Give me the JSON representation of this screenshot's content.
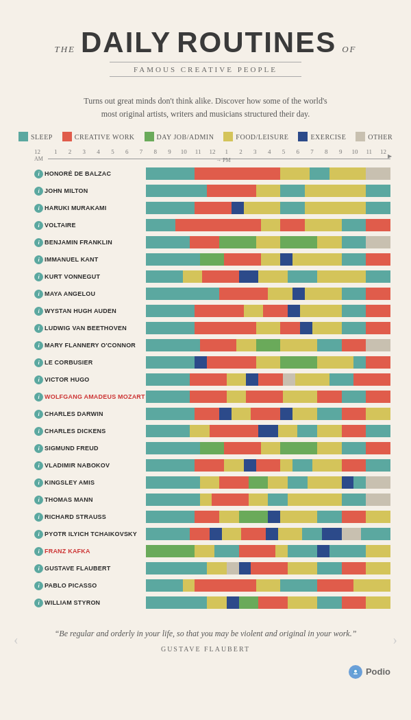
{
  "header": {
    "the": "THE",
    "daily": "DAILY",
    "routines": "ROUTINES",
    "of": "OF",
    "subtitle": "Famous Creative People",
    "description1": "Turns out great minds don't think alike. Discover how some of the world's",
    "description2": "most original artists, writers and musicians structured their day."
  },
  "legend": [
    {
      "label": "Sleep",
      "color": "sleep",
      "key": "sleep"
    },
    {
      "label": "Creative Work",
      "color": "creative",
      "key": "creative"
    },
    {
      "label": "Day Job/Admin",
      "color": "dayjob",
      "key": "dayjob"
    },
    {
      "label": "Food/Leisure",
      "color": "food",
      "key": "food"
    },
    {
      "label": "Exercise",
      "color": "exercise",
      "key": "exercise"
    },
    {
      "label": "Other",
      "color": "other",
      "key": "other"
    }
  ],
  "time_labels": [
    "12",
    "1",
    "2",
    "3",
    "4",
    "5",
    "6",
    "7",
    "8",
    "9",
    "10",
    "11",
    "12",
    "1",
    "2",
    "3",
    "4",
    "5",
    "6",
    "7",
    "8",
    "9",
    "10",
    "11",
    "12"
  ],
  "am_label": "AM",
  "pm_label": "PM",
  "people": [
    {
      "name": "Honoré de Balzac",
      "name_color": "dark",
      "bars": [
        {
          "type": "sleep",
          "pct": 20
        },
        {
          "type": "creative",
          "pct": 35
        },
        {
          "type": "food",
          "pct": 12
        },
        {
          "type": "sleep",
          "pct": 8
        },
        {
          "type": "food",
          "pct": 15
        },
        {
          "type": "other",
          "pct": 10
        }
      ]
    },
    {
      "name": "John Milton",
      "name_color": "dark",
      "bars": [
        {
          "type": "sleep",
          "pct": 25
        },
        {
          "type": "creative",
          "pct": 20
        },
        {
          "type": "food",
          "pct": 10
        },
        {
          "type": "sleep",
          "pct": 10
        },
        {
          "type": "food",
          "pct": 25
        },
        {
          "type": "sleep",
          "pct": 10
        }
      ]
    },
    {
      "name": "Haruki Murakami",
      "name_color": "dark",
      "bars": [
        {
          "type": "sleep",
          "pct": 20
        },
        {
          "type": "creative",
          "pct": 15
        },
        {
          "type": "exercise",
          "pct": 5
        },
        {
          "type": "food",
          "pct": 15
        },
        {
          "type": "sleep",
          "pct": 10
        },
        {
          "type": "food",
          "pct": 25
        },
        {
          "type": "sleep",
          "pct": 10
        }
      ]
    },
    {
      "name": "Voltaire",
      "name_color": "dark",
      "bars": [
        {
          "type": "sleep",
          "pct": 12
        },
        {
          "type": "creative",
          "pct": 35
        },
        {
          "type": "food",
          "pct": 8
        },
        {
          "type": "creative",
          "pct": 10
        },
        {
          "type": "food",
          "pct": 15
        },
        {
          "type": "sleep",
          "pct": 10
        },
        {
          "type": "creative",
          "pct": 10
        }
      ]
    },
    {
      "name": "Benjamin Franklin",
      "name_color": "dark",
      "bars": [
        {
          "type": "sleep",
          "pct": 18
        },
        {
          "type": "creative",
          "pct": 12
        },
        {
          "type": "dayjob",
          "pct": 15
        },
        {
          "type": "food",
          "pct": 10
        },
        {
          "type": "dayjob",
          "pct": 15
        },
        {
          "type": "food",
          "pct": 10
        },
        {
          "type": "sleep",
          "pct": 10
        },
        {
          "type": "other",
          "pct": 10
        }
      ]
    },
    {
      "name": "Immanuel Kant",
      "name_color": "dark",
      "bars": [
        {
          "type": "sleep",
          "pct": 22
        },
        {
          "type": "dayjob",
          "pct": 10
        },
        {
          "type": "creative",
          "pct": 15
        },
        {
          "type": "food",
          "pct": 8
        },
        {
          "type": "exercise",
          "pct": 5
        },
        {
          "type": "food",
          "pct": 20
        },
        {
          "type": "sleep",
          "pct": 10
        },
        {
          "type": "creative",
          "pct": 10
        }
      ]
    },
    {
      "name": "Kurt Vonnegut",
      "name_color": "dark",
      "bars": [
        {
          "type": "sleep",
          "pct": 15
        },
        {
          "type": "food",
          "pct": 8
        },
        {
          "type": "creative",
          "pct": 15
        },
        {
          "type": "exercise",
          "pct": 8
        },
        {
          "type": "food",
          "pct": 12
        },
        {
          "type": "sleep",
          "pct": 12
        },
        {
          "type": "food",
          "pct": 20
        },
        {
          "type": "sleep",
          "pct": 10
        }
      ]
    },
    {
      "name": "Maya Angelou",
      "name_color": "dark",
      "bars": [
        {
          "type": "sleep",
          "pct": 30
        },
        {
          "type": "creative",
          "pct": 20
        },
        {
          "type": "food",
          "pct": 10
        },
        {
          "type": "exercise",
          "pct": 5
        },
        {
          "type": "food",
          "pct": 15
        },
        {
          "type": "sleep",
          "pct": 10
        },
        {
          "type": "creative",
          "pct": 10
        }
      ]
    },
    {
      "name": "Wystan Hugh Auden",
      "name_color": "dark",
      "bars": [
        {
          "type": "sleep",
          "pct": 20
        },
        {
          "type": "creative",
          "pct": 20
        },
        {
          "type": "food",
          "pct": 8
        },
        {
          "type": "creative",
          "pct": 10
        },
        {
          "type": "exercise",
          "pct": 5
        },
        {
          "type": "food",
          "pct": 17
        },
        {
          "type": "sleep",
          "pct": 10
        },
        {
          "type": "creative",
          "pct": 10
        }
      ]
    },
    {
      "name": "Ludwig van Beethoven",
      "name_color": "dark",
      "bars": [
        {
          "type": "sleep",
          "pct": 20
        },
        {
          "type": "creative",
          "pct": 25
        },
        {
          "type": "food",
          "pct": 10
        },
        {
          "type": "creative",
          "pct": 8
        },
        {
          "type": "exercise",
          "pct": 5
        },
        {
          "type": "food",
          "pct": 12
        },
        {
          "type": "sleep",
          "pct": 10
        },
        {
          "type": "creative",
          "pct": 10
        }
      ]
    },
    {
      "name": "Mary Flannery O'Connor",
      "name_color": "dark",
      "bars": [
        {
          "type": "sleep",
          "pct": 22
        },
        {
          "type": "creative",
          "pct": 15
        },
        {
          "type": "food",
          "pct": 8
        },
        {
          "type": "dayjob",
          "pct": 10
        },
        {
          "type": "food",
          "pct": 15
        },
        {
          "type": "sleep",
          "pct": 10
        },
        {
          "type": "creative",
          "pct": 10
        },
        {
          "type": "other",
          "pct": 10
        }
      ]
    },
    {
      "name": "Le Corbusier",
      "name_color": "dark",
      "bars": [
        {
          "type": "sleep",
          "pct": 20
        },
        {
          "type": "exercise",
          "pct": 5
        },
        {
          "type": "creative",
          "pct": 20
        },
        {
          "type": "food",
          "pct": 10
        },
        {
          "type": "dayjob",
          "pct": 15
        },
        {
          "type": "food",
          "pct": 15
        },
        {
          "type": "sleep",
          "pct": 5
        },
        {
          "type": "creative",
          "pct": 10
        }
      ]
    },
    {
      "name": "Victor Hugo",
      "name_color": "dark",
      "bars": [
        {
          "type": "sleep",
          "pct": 18
        },
        {
          "type": "creative",
          "pct": 15
        },
        {
          "type": "food",
          "pct": 8
        },
        {
          "type": "exercise",
          "pct": 5
        },
        {
          "type": "creative",
          "pct": 10
        },
        {
          "type": "other",
          "pct": 5
        },
        {
          "type": "food",
          "pct": 14
        },
        {
          "type": "sleep",
          "pct": 10
        },
        {
          "type": "creative",
          "pct": 15
        }
      ]
    },
    {
      "name": "Wolfgang Amadeus Mozart",
      "name_color": "red",
      "bars": [
        {
          "type": "sleep",
          "pct": 18
        },
        {
          "type": "creative",
          "pct": 15
        },
        {
          "type": "food",
          "pct": 8
        },
        {
          "type": "creative",
          "pct": 15
        },
        {
          "type": "food",
          "pct": 14
        },
        {
          "type": "creative",
          "pct": 10
        },
        {
          "type": "sleep",
          "pct": 10
        },
        {
          "type": "creative",
          "pct": 10
        }
      ]
    },
    {
      "name": "Charles Darwin",
      "name_color": "dark",
      "bars": [
        {
          "type": "sleep",
          "pct": 20
        },
        {
          "type": "creative",
          "pct": 10
        },
        {
          "type": "exercise",
          "pct": 5
        },
        {
          "type": "food",
          "pct": 8
        },
        {
          "type": "creative",
          "pct": 12
        },
        {
          "type": "exercise",
          "pct": 5
        },
        {
          "type": "food",
          "pct": 10
        },
        {
          "type": "sleep",
          "pct": 10
        },
        {
          "type": "creative",
          "pct": 10
        },
        {
          "type": "food",
          "pct": 10
        }
      ]
    },
    {
      "name": "Charles Dickens",
      "name_color": "dark",
      "bars": [
        {
          "type": "sleep",
          "pct": 18
        },
        {
          "type": "food",
          "pct": 8
        },
        {
          "type": "creative",
          "pct": 20
        },
        {
          "type": "exercise",
          "pct": 8
        },
        {
          "type": "food",
          "pct": 8
        },
        {
          "type": "sleep",
          "pct": 8
        },
        {
          "type": "food",
          "pct": 10
        },
        {
          "type": "creative",
          "pct": 10
        },
        {
          "type": "sleep",
          "pct": 10
        }
      ]
    },
    {
      "name": "Sigmund Freud",
      "name_color": "dark",
      "bars": [
        {
          "type": "sleep",
          "pct": 22
        },
        {
          "type": "dayjob",
          "pct": 10
        },
        {
          "type": "creative",
          "pct": 15
        },
        {
          "type": "food",
          "pct": 8
        },
        {
          "type": "dayjob",
          "pct": 15
        },
        {
          "type": "food",
          "pct": 10
        },
        {
          "type": "sleep",
          "pct": 10
        },
        {
          "type": "creative",
          "pct": 10
        }
      ]
    },
    {
      "name": "Vladimir Nabokov",
      "name_color": "dark",
      "bars": [
        {
          "type": "sleep",
          "pct": 20
        },
        {
          "type": "creative",
          "pct": 12
        },
        {
          "type": "food",
          "pct": 8
        },
        {
          "type": "exercise",
          "pct": 5
        },
        {
          "type": "creative",
          "pct": 10
        },
        {
          "type": "food",
          "pct": 5
        },
        {
          "type": "sleep",
          "pct": 8
        },
        {
          "type": "food",
          "pct": 12
        },
        {
          "type": "creative",
          "pct": 10
        },
        {
          "type": "sleep",
          "pct": 10
        }
      ]
    },
    {
      "name": "Kingsley Amis",
      "name_color": "dark",
      "bars": [
        {
          "type": "sleep",
          "pct": 22
        },
        {
          "type": "food",
          "pct": 8
        },
        {
          "type": "creative",
          "pct": 12
        },
        {
          "type": "dayjob",
          "pct": 8
        },
        {
          "type": "food",
          "pct": 8
        },
        {
          "type": "sleep",
          "pct": 8
        },
        {
          "type": "food",
          "pct": 14
        },
        {
          "type": "exercise",
          "pct": 5
        },
        {
          "type": "sleep",
          "pct": 5
        },
        {
          "type": "other",
          "pct": 10
        }
      ]
    },
    {
      "name": "Thomas Mann",
      "name_color": "dark",
      "bars": [
        {
          "type": "sleep",
          "pct": 22
        },
        {
          "type": "food",
          "pct": 5
        },
        {
          "type": "creative",
          "pct": 15
        },
        {
          "type": "food",
          "pct": 8
        },
        {
          "type": "sleep",
          "pct": 8
        },
        {
          "type": "food",
          "pct": 22
        },
        {
          "type": "sleep",
          "pct": 10
        },
        {
          "type": "other",
          "pct": 10
        }
      ]
    },
    {
      "name": "Richard Strauss",
      "name_color": "dark",
      "bars": [
        {
          "type": "sleep",
          "pct": 20
        },
        {
          "type": "creative",
          "pct": 10
        },
        {
          "type": "food",
          "pct": 8
        },
        {
          "type": "dayjob",
          "pct": 12
        },
        {
          "type": "exercise",
          "pct": 5
        },
        {
          "type": "food",
          "pct": 15
        },
        {
          "type": "sleep",
          "pct": 10
        },
        {
          "type": "creative",
          "pct": 10
        },
        {
          "type": "food",
          "pct": 10
        }
      ]
    },
    {
      "name": "Pyotr Ilyich Tchaikovsky",
      "name_color": "dark",
      "bars": [
        {
          "type": "sleep",
          "pct": 18
        },
        {
          "type": "creative",
          "pct": 8
        },
        {
          "type": "exercise",
          "pct": 5
        },
        {
          "type": "food",
          "pct": 8
        },
        {
          "type": "creative",
          "pct": 10
        },
        {
          "type": "exercise",
          "pct": 5
        },
        {
          "type": "food",
          "pct": 10
        },
        {
          "type": "sleep",
          "pct": 8
        },
        {
          "type": "exercise",
          "pct": 8
        },
        {
          "type": "other",
          "pct": 8
        },
        {
          "type": "sleep",
          "pct": 12
        }
      ]
    },
    {
      "name": "Franz Kafka",
      "name_color": "red",
      "bars": [
        {
          "type": "dayjob",
          "pct": 20
        },
        {
          "type": "food",
          "pct": 8
        },
        {
          "type": "sleep",
          "pct": 10
        },
        {
          "type": "creative",
          "pct": 15
        },
        {
          "type": "food",
          "pct": 5
        },
        {
          "type": "sleep",
          "pct": 12
        },
        {
          "type": "exercise",
          "pct": 5
        },
        {
          "type": "sleep",
          "pct": 15
        },
        {
          "type": "food",
          "pct": 10
        }
      ]
    },
    {
      "name": "Gustave Flaubert",
      "name_color": "dark",
      "bars": [
        {
          "type": "sleep",
          "pct": 25
        },
        {
          "type": "food",
          "pct": 8
        },
        {
          "type": "other",
          "pct": 5
        },
        {
          "type": "exercise",
          "pct": 5
        },
        {
          "type": "creative",
          "pct": 15
        },
        {
          "type": "food",
          "pct": 12
        },
        {
          "type": "sleep",
          "pct": 10
        },
        {
          "type": "creative",
          "pct": 10
        },
        {
          "type": "food",
          "pct": 10
        }
      ]
    },
    {
      "name": "Pablo Picasso",
      "name_color": "dark",
      "bars": [
        {
          "type": "sleep",
          "pct": 15
        },
        {
          "type": "food",
          "pct": 5
        },
        {
          "type": "creative",
          "pct": 25
        },
        {
          "type": "food",
          "pct": 10
        },
        {
          "type": "sleep",
          "pct": 15
        },
        {
          "type": "creative",
          "pct": 15
        },
        {
          "type": "food",
          "pct": 15
        }
      ]
    },
    {
      "name": "William Styron",
      "name_color": "dark",
      "bars": [
        {
          "type": "sleep",
          "pct": 25
        },
        {
          "type": "food",
          "pct": 8
        },
        {
          "type": "exercise",
          "pct": 5
        },
        {
          "type": "dayjob",
          "pct": 8
        },
        {
          "type": "creative",
          "pct": 12
        },
        {
          "type": "food",
          "pct": 12
        },
        {
          "type": "sleep",
          "pct": 10
        },
        {
          "type": "creative",
          "pct": 10
        },
        {
          "type": "food",
          "pct": 10
        }
      ]
    }
  ],
  "quote": {
    "text": "“Be regular and orderly in your life, so that you may be violent and original in your work.”",
    "author": "Gustave Flaubert"
  },
  "footer": {
    "brand": "Podio"
  }
}
